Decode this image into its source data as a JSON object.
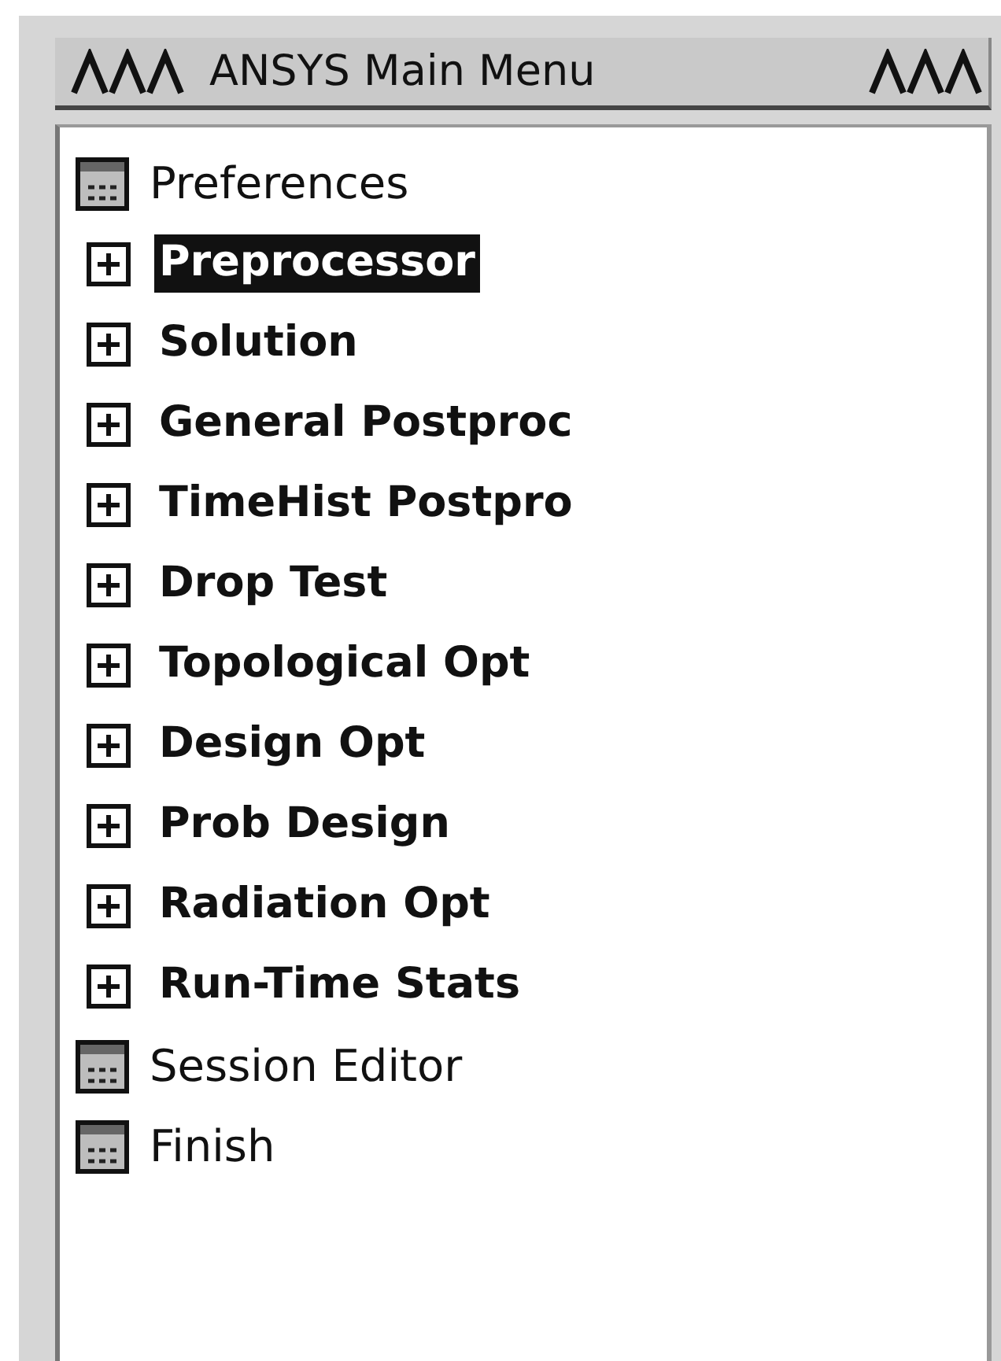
{
  "window": {
    "title": "ANSYS Main Menu"
  },
  "items": [
    {
      "kind": "dialog",
      "label": "Preferences",
      "selected": false
    },
    {
      "kind": "folder",
      "label": "Preprocessor",
      "selected": true,
      "expanded": false
    },
    {
      "kind": "folder",
      "label": "Solution",
      "selected": false,
      "expanded": false
    },
    {
      "kind": "folder",
      "label": "General Postproc",
      "selected": false,
      "expanded": false
    },
    {
      "kind": "folder",
      "label": "TimeHist Postpro",
      "selected": false,
      "expanded": false
    },
    {
      "kind": "folder",
      "label": "Drop Test",
      "selected": false,
      "expanded": false
    },
    {
      "kind": "folder",
      "label": "Topological Opt",
      "selected": false,
      "expanded": false
    },
    {
      "kind": "folder",
      "label": "Design Opt",
      "selected": false,
      "expanded": false
    },
    {
      "kind": "folder",
      "label": "Prob Design",
      "selected": false,
      "expanded": false
    },
    {
      "kind": "folder",
      "label": "Radiation Opt",
      "selected": false,
      "expanded": false
    },
    {
      "kind": "folder",
      "label": "Run-Time Stats",
      "selected": false,
      "expanded": false
    },
    {
      "kind": "dialog",
      "label": "Session Editor",
      "selected": false
    },
    {
      "kind": "dialog",
      "label": "Finish",
      "selected": false
    }
  ]
}
